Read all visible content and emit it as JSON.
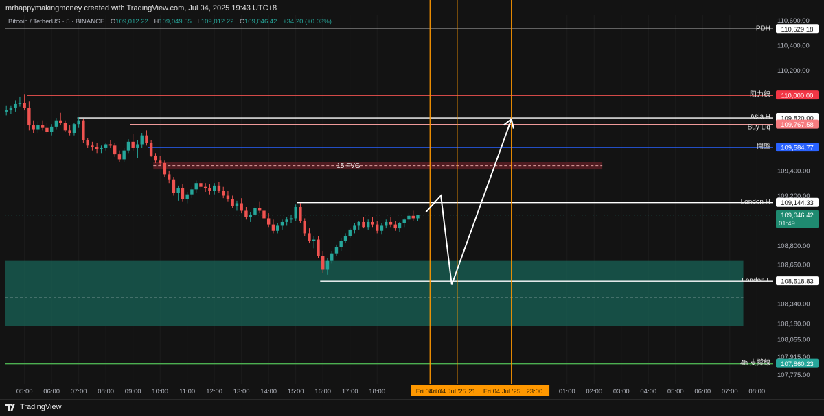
{
  "header": {
    "title": "mrhappymakingmoney created with TradingView.com, Jul 04, 2025 19:43 UTC+8",
    "symbol": "Bitcoin / TetherUS · 5 · BINANCE",
    "ohlc": {
      "o_label": "O",
      "o": "109,012.22",
      "h_label": "H",
      "h": "109,049.55",
      "l_label": "L",
      "l": "109,012.22",
      "c_label": "C",
      "c": "109,046.42",
      "change": "+34.20 (+0.03%)"
    }
  },
  "footer": {
    "brand": "TradingView"
  },
  "colors": {
    "background": "#131313",
    "up": "#26a69a",
    "down": "#ef5350",
    "orange": "#ff9800",
    "zone": "#1b5e54",
    "fvg": "#5a1e24"
  },
  "chart_data": {
    "type": "candlestick",
    "title": "",
    "ylim": [
      107700,
      110640
    ],
    "y_ticks": [
      "110,600.00",
      "110,400.00",
      "110,200.00",
      "109,600.00",
      "109,400.00",
      "109,200.00",
      "108,800.00",
      "108,650.00",
      "108,340.00",
      "108,180.00",
      "108,055.00",
      "107,915.00",
      "107,775.00"
    ],
    "y_tick_values": [
      110600,
      110400,
      110200,
      109600,
      109400,
      109200,
      108800,
      108650,
      108340,
      108180,
      108055,
      107915,
      107775
    ],
    "x_ticks": [
      "05:00",
      "06:00",
      "07:00",
      "08:00",
      "09:00",
      "10:00",
      "11:00",
      "12:00",
      "13:00",
      "14:00",
      "15:00",
      "16:00",
      "17:00",
      "18:00",
      "01:00",
      "02:00",
      "03:00",
      "04:00",
      "05:00",
      "06:00",
      "07:00",
      "08:00"
    ],
    "x_tick_hours": [
      5,
      6,
      7,
      8,
      9,
      10,
      11,
      12,
      13,
      14,
      15,
      16,
      17,
      18,
      25,
      26,
      27,
      28,
      29,
      30,
      31,
      32
    ],
    "x_range_hours": [
      4.3,
      32.6
    ],
    "time_labels": [
      {
        "text": "Fri 04 Ju",
        "hour": 19.9
      },
      {
        "text": "Fri 04 Jul '25",
        "hour": 20.6
      },
      {
        "text": "21",
        "hour": 21.5
      },
      {
        "text": "Fri 04 Jul '25",
        "hour": 22.6
      },
      {
        "text": "23:00",
        "hour": 23.8
      }
    ],
    "levels": [
      {
        "label": "PDH",
        "value": 110529.18,
        "value_text": "110,529.18",
        "color": "#e6e6e6",
        "tag_bg": "#ffffff",
        "tag_fg": "#131313",
        "from_hour": 4.3
      },
      {
        "label": "阻力線",
        "value": 110000.0,
        "value_text": "110,000.00",
        "color": "#ef5350",
        "tag_bg": "#f23645",
        "tag_fg": "#ffffff",
        "from_hour": 5.1
      },
      {
        "label": "Asia H",
        "value": 109820.0,
        "value_text": "109,820.00",
        "color": "#ffffff",
        "tag_bg": "#ffffff",
        "tag_fg": "#131313",
        "from_hour": 6.95
      },
      {
        "label": "Buy Liq",
        "value": 109767.58,
        "value_text": "109,767.58",
        "color": "#ef9a9a",
        "tag_bg": "#f77c80",
        "tag_fg": "#ffffff",
        "from_hour": 8.9
      },
      {
        "label": "開盤",
        "value": 109584.77,
        "value_text": "109,584.77",
        "color": "#2962ff",
        "tag_bg": "#2962ff",
        "tag_fg": "#ffffff",
        "from_hour": 9.55
      },
      {
        "label": "London H",
        "value": 109144.33,
        "value_text": "109,144.33",
        "color": "#ffffff",
        "tag_bg": "#ffffff",
        "tag_fg": "#131313",
        "from_hour": 15.05
      },
      {
        "label": "London L",
        "value": 108518.83,
        "value_text": "108,518.83",
        "color": "#ffffff",
        "tag_bg": "#ffffff",
        "tag_fg": "#131313",
        "from_hour": 15.9
      },
      {
        "label": "4h 支撐線",
        "value": 107860.23,
        "value_text": "107,860.23",
        "color": "#4caf50",
        "tag_bg": "#26a69a",
        "tag_fg": "#ffffff",
        "from_hour": 4.3
      }
    ],
    "last_price": {
      "value": 109046.42,
      "value_text": "109,046.42",
      "countdown": "01:49"
    },
    "fvg": {
      "label": "15 FVG",
      "top": 109470,
      "bottom": 109410,
      "from_hour": 9.75,
      "to_hour": 26.3
    },
    "demand_zone": {
      "top": 108680,
      "bottom": 108160,
      "from_hour": 4.3,
      "to_hour": 31.5,
      "mid": 108390
    },
    "vertical_lines_hours": [
      19.95,
      20.95,
      22.95
    ],
    "projection": [
      [
        19.8,
        109070
      ],
      [
        20.35,
        109200
      ],
      [
        20.75,
        108490
      ],
      [
        22.95,
        109810
      ]
    ],
    "candles": [
      [
        4.33,
        109870,
        109920,
        109840,
        109880
      ],
      [
        4.5,
        109880,
        109920,
        109850,
        109900
      ],
      [
        4.67,
        109900,
        109960,
        109870,
        109930
      ],
      [
        4.83,
        109930,
        109990,
        109910,
        109940
      ],
      [
        5.0,
        109940,
        110010,
        109880,
        109900
      ],
      [
        5.17,
        109900,
        109950,
        109720,
        109760
      ],
      [
        5.33,
        109760,
        109800,
        109700,
        109730
      ],
      [
        5.5,
        109730,
        109790,
        109700,
        109760
      ],
      [
        5.67,
        109760,
        109800,
        109720,
        109740
      ],
      [
        5.83,
        109740,
        109780,
        109690,
        109710
      ],
      [
        6.0,
        109710,
        109770,
        109680,
        109750
      ],
      [
        6.17,
        109750,
        109820,
        109730,
        109800
      ],
      [
        6.33,
        109800,
        109860,
        109760,
        109780
      ],
      [
        6.5,
        109780,
        109800,
        109710,
        109720
      ],
      [
        6.67,
        109720,
        109760,
        109680,
        109700
      ],
      [
        6.83,
        109700,
        109780,
        109680,
        109770
      ],
      [
        7.0,
        109770,
        109830,
        109740,
        109800
      ],
      [
        7.17,
        109800,
        109810,
        109620,
        109640
      ],
      [
        7.33,
        109640,
        109660,
        109580,
        109600
      ],
      [
        7.5,
        109600,
        109630,
        109560,
        109590
      ],
      [
        7.67,
        109590,
        109620,
        109540,
        109570
      ],
      [
        7.83,
        109570,
        109600,
        109540,
        109580
      ],
      [
        8.0,
        109580,
        109620,
        109560,
        109610
      ],
      [
        8.17,
        109610,
        109640,
        109580,
        109600
      ],
      [
        8.33,
        109600,
        109620,
        109510,
        109530
      ],
      [
        8.5,
        109530,
        109560,
        109470,
        109490
      ],
      [
        8.67,
        109490,
        109580,
        109470,
        109560
      ],
      [
        8.83,
        109560,
        109650,
        109540,
        109630
      ],
      [
        9.0,
        109630,
        109690,
        109560,
        109580
      ],
      [
        9.17,
        109580,
        109640,
        109500,
        109610
      ],
      [
        9.33,
        109610,
        109700,
        109580,
        109680
      ],
      [
        9.5,
        109680,
        109720,
        109600,
        109620
      ],
      [
        9.67,
        109620,
        109640,
        109510,
        109520
      ],
      [
        9.83,
        109520,
        109540,
        109460,
        109480
      ],
      [
        10.0,
        109480,
        109520,
        109440,
        109460
      ],
      [
        10.17,
        109460,
        109480,
        109350,
        109370
      ],
      [
        10.33,
        109370,
        109400,
        109300,
        109330
      ],
      [
        10.5,
        109330,
        109350,
        109200,
        109220
      ],
      [
        10.67,
        109220,
        109280,
        109160,
        109260
      ],
      [
        10.83,
        109260,
        109290,
        109150,
        109170
      ],
      [
        11.0,
        109170,
        109230,
        109140,
        109210
      ],
      [
        11.17,
        109210,
        109270,
        109180,
        109250
      ],
      [
        11.33,
        109250,
        109320,
        109220,
        109300
      ],
      [
        11.5,
        109300,
        109330,
        109250,
        109270
      ],
      [
        11.67,
        109270,
        109300,
        109230,
        109260
      ],
      [
        11.83,
        109260,
        109290,
        109210,
        109240
      ],
      [
        12.0,
        109240,
        109300,
        109210,
        109280
      ],
      [
        12.17,
        109280,
        109310,
        109220,
        109240
      ],
      [
        12.33,
        109240,
        109270,
        109180,
        109200
      ],
      [
        12.5,
        109200,
        109240,
        109150,
        109170
      ],
      [
        12.67,
        109170,
        109200,
        109100,
        109120
      ],
      [
        12.83,
        109120,
        109160,
        109080,
        109140
      ],
      [
        13.0,
        109140,
        109180,
        109060,
        109080
      ],
      [
        13.17,
        109080,
        109110,
        109010,
        109030
      ],
      [
        13.33,
        109030,
        109070,
        108990,
        109050
      ],
      [
        13.5,
        109050,
        109120,
        109030,
        109100
      ],
      [
        13.67,
        109100,
        109150,
        109060,
        109080
      ],
      [
        13.83,
        109080,
        109100,
        109000,
        109020
      ],
      [
        14.0,
        109020,
        109060,
        108950,
        108970
      ],
      [
        14.17,
        108970,
        109010,
        108900,
        108920
      ],
      [
        14.33,
        108920,
        108980,
        108900,
        108960
      ],
      [
        14.5,
        108960,
        109010,
        108930,
        108990
      ],
      [
        14.67,
        108990,
        109030,
        108960,
        109010
      ],
      [
        14.83,
        109010,
        109050,
        108980,
        109020
      ],
      [
        15.0,
        109020,
        109130,
        109000,
        109110
      ],
      [
        15.17,
        109110,
        109140,
        108980,
        109000
      ],
      [
        15.33,
        109000,
        109020,
        108880,
        108900
      ],
      [
        15.5,
        108900,
        108940,
        108820,
        108840
      ],
      [
        15.67,
        108840,
        108880,
        108780,
        108850
      ],
      [
        15.83,
        108850,
        108880,
        108700,
        108720
      ],
      [
        16.0,
        108720,
        108760,
        108580,
        108610
      ],
      [
        16.17,
        108610,
        108700,
        108570,
        108680
      ],
      [
        16.33,
        108680,
        108760,
        108660,
        108740
      ],
      [
        16.5,
        108740,
        108810,
        108720,
        108790
      ],
      [
        16.67,
        108790,
        108860,
        108760,
        108840
      ],
      [
        16.83,
        108840,
        108900,
        108820,
        108880
      ],
      [
        17.0,
        108880,
        108940,
        108860,
        108930
      ],
      [
        17.17,
        108930,
        108980,
        108900,
        108960
      ],
      [
        17.33,
        108960,
        109000,
        108930,
        108990
      ],
      [
        17.5,
        108990,
        109030,
        108940,
        108950
      ],
      [
        17.67,
        108950,
        109010,
        108930,
        108990
      ],
      [
        17.83,
        108990,
        109030,
        108950,
        108970
      ],
      [
        18.0,
        108970,
        109000,
        108900,
        108920
      ],
      [
        18.17,
        108920,
        108980,
        108890,
        108960
      ],
      [
        18.33,
        108960,
        109010,
        108940,
        108990
      ],
      [
        18.5,
        108990,
        109030,
        108950,
        108970
      ],
      [
        18.67,
        108970,
        109000,
        108920,
        108940
      ],
      [
        18.83,
        108940,
        108990,
        108910,
        108980
      ],
      [
        19.0,
        108980,
        109020,
        108950,
        109010
      ],
      [
        19.17,
        109010,
        109060,
        108990,
        109040
      ],
      [
        19.33,
        109040,
        109080,
        109000,
        109020
      ],
      [
        19.5,
        109020,
        109050,
        109000,
        109046
      ]
    ]
  }
}
